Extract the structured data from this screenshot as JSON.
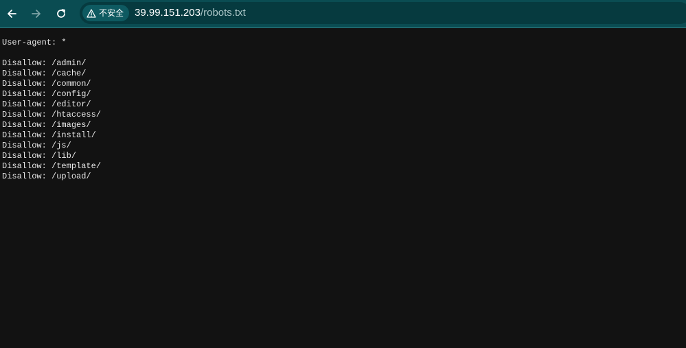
{
  "browser": {
    "back_icon": "arrow-left-icon",
    "forward_icon": "arrow-right-icon",
    "reload_icon": "reload-icon",
    "security_icon": "warning-triangle-icon",
    "security_label": "不安全",
    "url_host": "39.99.151.203",
    "url_path": "/robots.txt",
    "colors": {
      "toolbar": "#0a4c52",
      "omnibox": "#063a3f",
      "page_background": "#121212",
      "page_text": "#e8e8e8"
    }
  },
  "document": {
    "lines": [
      "User-agent: *",
      "",
      "Disallow: /admin/",
      "Disallow: /cache/",
      "Disallow: /common/",
      "Disallow: /config/",
      "Disallow: /editor/",
      "Disallow: /htaccess/",
      "Disallow: /images/",
      "Disallow: /install/",
      "Disallow: /js/",
      "Disallow: /lib/",
      "Disallow: /template/",
      "Disallow: /upload/"
    ]
  }
}
